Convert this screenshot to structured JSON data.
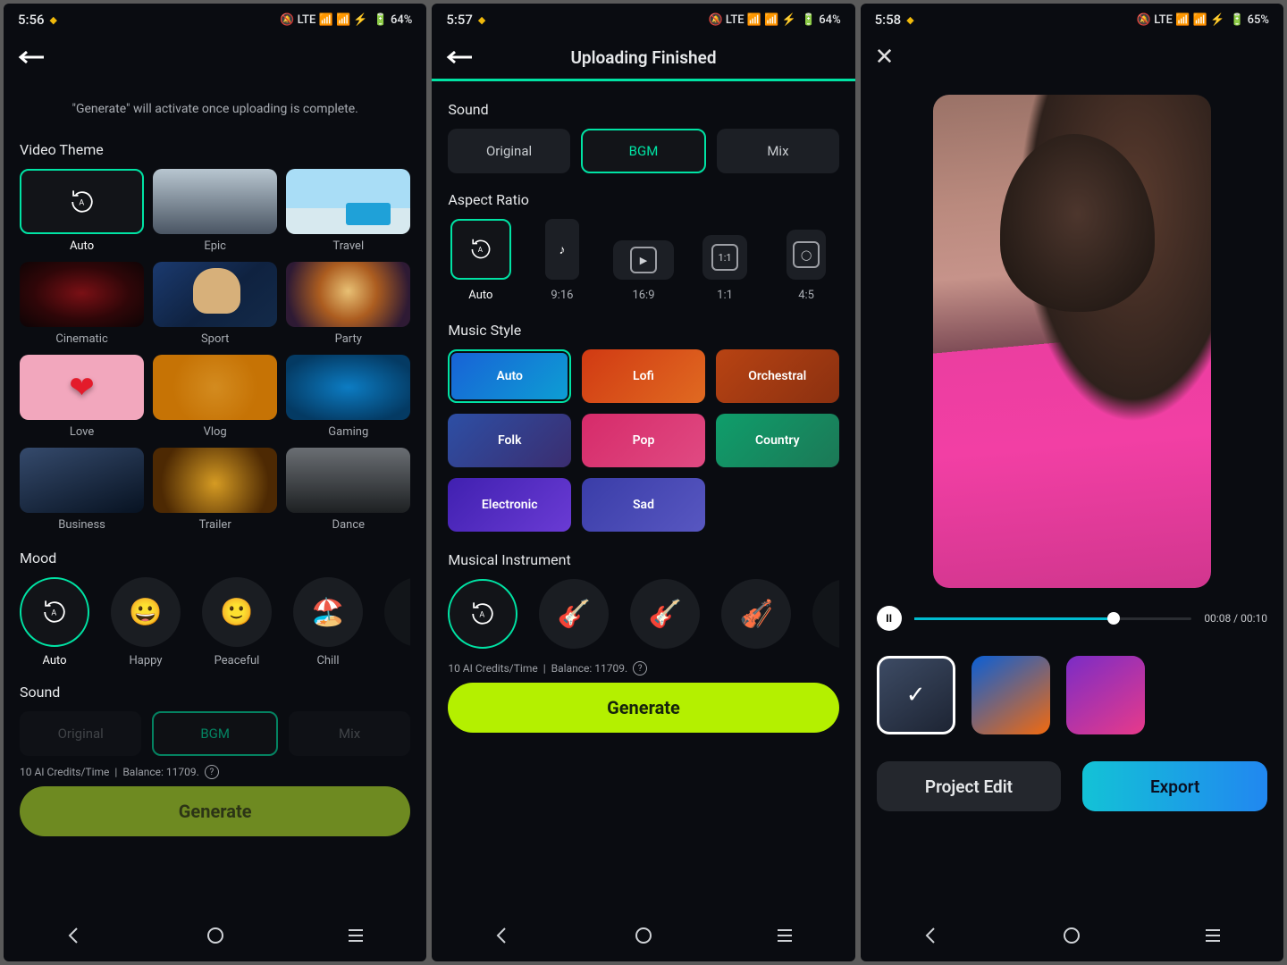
{
  "status": {
    "times": [
      "5:56",
      "5:57",
      "5:58"
    ],
    "icons": "🔕 LTE 📶 📶 ⚡",
    "batteries": [
      "64%",
      "64%",
      "65%"
    ]
  },
  "screen1": {
    "hint": "\"Generate\" will activate once uploading is complete.",
    "theme": {
      "title": "Video Theme",
      "items": [
        "Auto",
        "Epic",
        "Travel",
        "Cinematic",
        "Sport",
        "Party",
        "Love",
        "Vlog",
        "Gaming",
        "Business",
        "Trailer",
        "Dance"
      ]
    },
    "mood": {
      "title": "Mood",
      "items": [
        "Auto",
        "Happy",
        "Peaceful",
        "Chill"
      ],
      "emoji": [
        "",
        "😀",
        "🙂",
        "🏖️"
      ]
    },
    "sound": {
      "title": "Sound",
      "items": [
        "Original",
        "BGM",
        "Mix"
      ]
    },
    "credits_a": "10 AI Credits/Time",
    "credits_b": "Balance: 11709.",
    "generate": "Generate"
  },
  "screen2": {
    "title": "Uploading Finished",
    "sound": {
      "title": "Sound",
      "items": [
        "Original",
        "BGM",
        "Mix"
      ]
    },
    "aspect": {
      "title": "Aspect Ratio",
      "items": [
        "Auto",
        "9:16",
        "16:9",
        "1:1",
        "4:5"
      ]
    },
    "music": {
      "title": "Music Style",
      "items": [
        "Auto",
        "Lofi",
        "Orchestral",
        "Folk",
        "Pop",
        "Country",
        "Electronic",
        "Sad"
      ]
    },
    "instr": {
      "title": "Musical Instrument"
    },
    "credits_a": "10 AI Credits/Time",
    "credits_b": "Balance: 11709.",
    "generate": "Generate"
  },
  "screen3": {
    "time": "00:08 / 00:10",
    "project_edit": "Project Edit",
    "export": "Export"
  }
}
